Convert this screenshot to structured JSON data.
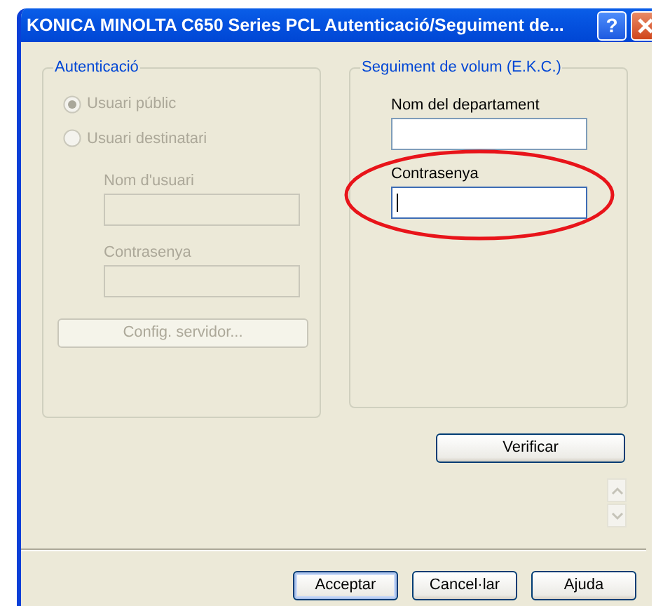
{
  "window": {
    "title": "KONICA MINOLTA C650 Series PCL Autenticació/Seguiment de...",
    "buttons": [
      {
        "kind": "help",
        "label": "?"
      },
      {
        "kind": "close"
      }
    ]
  },
  "authentication": {
    "title": "Autenticació",
    "disabled": true,
    "options": [
      {
        "label": "Usuari públic",
        "selected": true
      },
      {
        "label": "Usuari destinatari",
        "selected": false
      }
    ],
    "fields": [
      {
        "label": "Nom d'usuari"
      },
      {
        "label": "Contrasenya"
      }
    ],
    "button": "Config. servidor..."
  },
  "volume_tracking": {
    "title": "Seguiment de volum (E.K.C.)",
    "fields": [
      {
        "label": "Nom del departament",
        "focused": false,
        "highlighted": false
      },
      {
        "label": "Contrasenya",
        "focused": true,
        "highlighted": true
      }
    ],
    "button": "Verificar"
  },
  "spinner": {
    "disabled": true
  },
  "buttons": [
    {
      "label": "Acceptar",
      "default": true
    },
    {
      "label": "Cancel·lar",
      "default": false
    },
    {
      "label": "Ajuda",
      "default": false
    }
  ]
}
